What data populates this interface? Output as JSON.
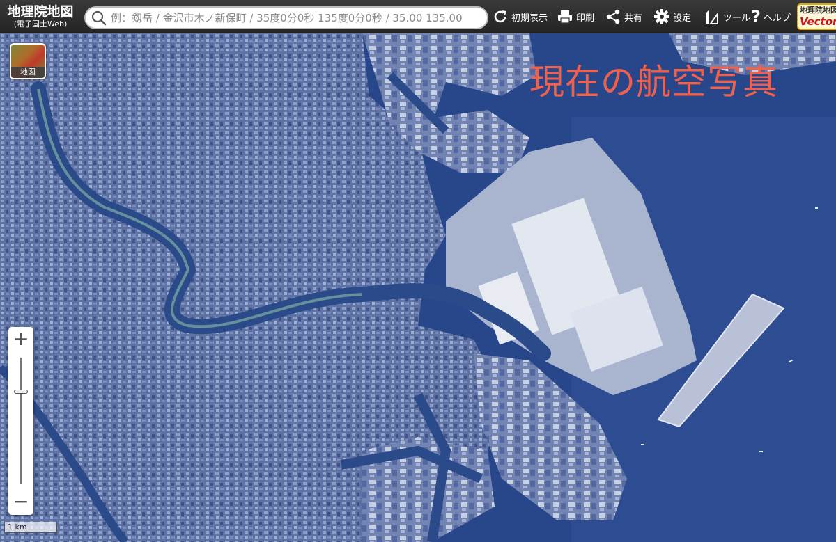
{
  "header": {
    "logo_title": "地理院地図",
    "logo_subtitle": "(電子国土Web)",
    "search_placeholder": "例：剱岳 / 金沢市木ノ新保町 / 35度0分0秒 135度0分0秒 / 35.00 135.00",
    "tools": [
      {
        "label": "初期表示",
        "icon": "reset-icon"
      },
      {
        "label": "印刷",
        "icon": "print-icon"
      },
      {
        "label": "共有",
        "icon": "share-icon"
      },
      {
        "label": "設定",
        "icon": "gear-icon"
      },
      {
        "label": "ツール",
        "icon": "tool-icon"
      },
      {
        "label": "ヘルプ",
        "icon": "help-icon"
      }
    ],
    "vector_badge": {
      "line1": "地理院地図",
      "line2": "Vector"
    }
  },
  "map": {
    "overlay_label": "現在の航空写真",
    "layer_button_label": "地図",
    "zoom_in": "+",
    "zoom_out": "−",
    "scale_label": "1 km",
    "colors": {
      "water": "#2b4c8e",
      "city": "#5b6e9e",
      "bay": "#28468a"
    }
  }
}
